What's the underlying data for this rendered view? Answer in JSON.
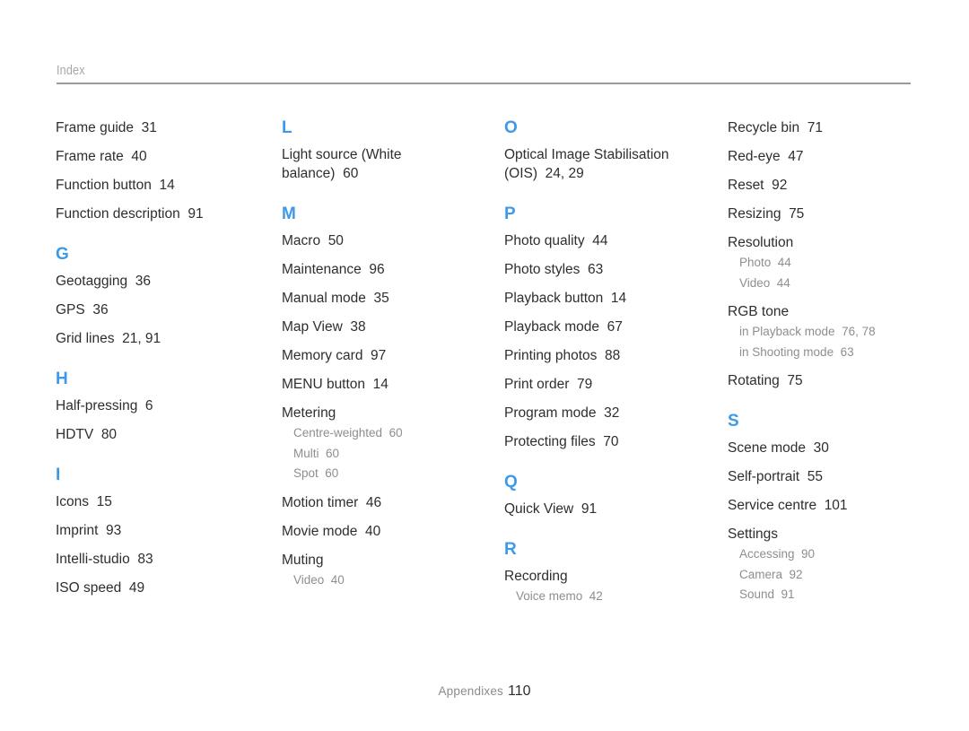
{
  "header": {
    "title": "Index"
  },
  "footer": {
    "section_label": "Appendixes",
    "page_number": "110"
  },
  "colors": {
    "letter_heading": "#3d9ae8",
    "entry_text": "#2e2e2e",
    "subentry_text": "#8e8e8e",
    "header_text": "#a6a6a6",
    "rule": "#9a9a9a"
  },
  "columns": [
    {
      "id": "column-1",
      "blocks": [
        {
          "letter": "",
          "entries": [
            {
              "label": "Frame guide",
              "pages": "31"
            },
            {
              "label": "Frame rate",
              "pages": "40"
            },
            {
              "label": "Function button",
              "pages": "14"
            },
            {
              "label": "Function description",
              "pages": "91"
            }
          ]
        },
        {
          "letter": "G",
          "entries": [
            {
              "label": "Geotagging",
              "pages": "36"
            },
            {
              "label": "GPS",
              "pages": "36"
            },
            {
              "label": "Grid lines",
              "pages": "21, 91"
            }
          ]
        },
        {
          "letter": "H",
          "entries": [
            {
              "label": "Half-pressing",
              "pages": "6"
            },
            {
              "label": "HDTV",
              "pages": "80"
            }
          ]
        },
        {
          "letter": "I",
          "entries": [
            {
              "label": "Icons",
              "pages": "15"
            },
            {
              "label": "Imprint",
              "pages": "93"
            },
            {
              "label": "Intelli-studio",
              "pages": "83"
            },
            {
              "label": "ISO speed",
              "pages": "49"
            }
          ]
        }
      ]
    },
    {
      "id": "column-2",
      "blocks": [
        {
          "letter": "L",
          "entries": [
            {
              "label": "Light source (White balance)",
              "pages": "60"
            }
          ]
        },
        {
          "letter": "M",
          "entries": [
            {
              "label": "Macro",
              "pages": "50"
            },
            {
              "label": "Maintenance",
              "pages": "96"
            },
            {
              "label": "Manual mode",
              "pages": "35"
            },
            {
              "label": "Map View",
              "pages": "38"
            },
            {
              "label": "Memory card",
              "pages": "97"
            },
            {
              "label": "MENU button",
              "pages": "14"
            },
            {
              "label": "Metering",
              "pages": "",
              "subs": [
                {
                  "label": "Centre-weighted",
                  "pages": "60"
                },
                {
                  "label": "Multi",
                  "pages": "60"
                },
                {
                  "label": "Spot",
                  "pages": "60"
                }
              ]
            },
            {
              "label": "Motion timer",
              "pages": "46"
            },
            {
              "label": "Movie mode",
              "pages": "40"
            },
            {
              "label": "Muting",
              "pages": "",
              "subs": [
                {
                  "label": "Video",
                  "pages": "40"
                }
              ]
            }
          ]
        }
      ]
    },
    {
      "id": "column-3",
      "blocks": [
        {
          "letter": "O",
          "entries": [
            {
              "label": "Optical Image Stabilisation (OIS)",
              "pages": "24, 29"
            }
          ]
        },
        {
          "letter": "P",
          "entries": [
            {
              "label": "Photo quality",
              "pages": "44"
            },
            {
              "label": "Photo styles",
              "pages": "63"
            },
            {
              "label": "Playback button",
              "pages": "14"
            },
            {
              "label": "Playback mode",
              "pages": "67"
            },
            {
              "label": "Printing photos",
              "pages": "88"
            },
            {
              "label": "Print order",
              "pages": "79"
            },
            {
              "label": "Program mode",
              "pages": "32"
            },
            {
              "label": "Protecting files",
              "pages": "70"
            }
          ]
        },
        {
          "letter": "Q",
          "entries": [
            {
              "label": "Quick View",
              "pages": "91"
            }
          ]
        },
        {
          "letter": "R",
          "entries": [
            {
              "label": "Recording",
              "pages": "",
              "subs": [
                {
                  "label": "Voice memo",
                  "pages": "42"
                }
              ]
            }
          ]
        }
      ]
    },
    {
      "id": "column-4",
      "blocks": [
        {
          "letter": "",
          "entries": [
            {
              "label": "Recycle bin",
              "pages": "71"
            },
            {
              "label": "Red-eye",
              "pages": "47"
            },
            {
              "label": "Reset",
              "pages": "92"
            },
            {
              "label": "Resizing",
              "pages": "75"
            },
            {
              "label": "Resolution",
              "pages": "",
              "subs": [
                {
                  "label": "Photo",
                  "pages": "44"
                },
                {
                  "label": "Video",
                  "pages": "44"
                }
              ]
            },
            {
              "label": "RGB tone",
              "pages": "",
              "subs": [
                {
                  "label": "in Playback mode",
                  "pages": "76, 78"
                },
                {
                  "label": "in Shooting mode",
                  "pages": "63"
                }
              ]
            },
            {
              "label": "Rotating",
              "pages": "75"
            }
          ]
        },
        {
          "letter": "S",
          "entries": [
            {
              "label": "Scene mode",
              "pages": "30"
            },
            {
              "label": "Self-portrait",
              "pages": "55"
            },
            {
              "label": "Service centre",
              "pages": "101"
            },
            {
              "label": "Settings",
              "pages": "",
              "subs": [
                {
                  "label": "Accessing",
                  "pages": "90"
                },
                {
                  "label": "Camera",
                  "pages": "92"
                },
                {
                  "label": "Sound",
                  "pages": "91"
                }
              ]
            }
          ]
        }
      ]
    }
  ]
}
